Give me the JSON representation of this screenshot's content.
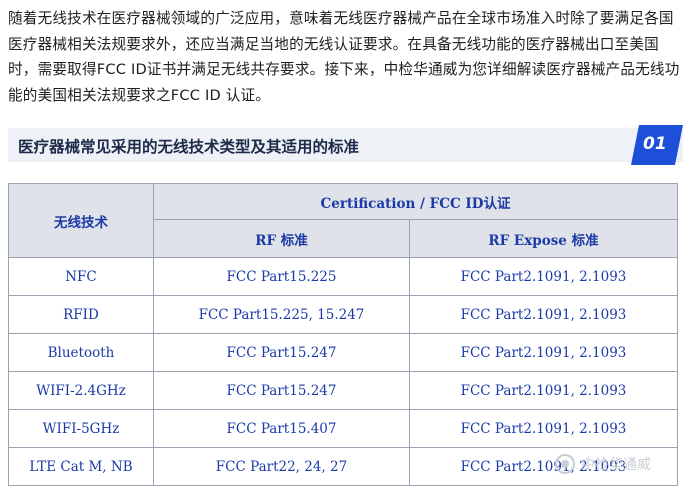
{
  "intro": "随着无线技术在医疗器械领域的广泛应用，意味着无线医疗器械产品在全球市场准入时除了要满足各国医疗器械相关法规要求外，还应当满足当地的无线认证要求。在具备无线功能的医疗器械出口至美国时，需要取得FCC ID证书并满足无线共存要求。接下来，中检华通威为您详细解读医疗器械产品无线功能的美国相关法规要求之FCC ID 认证。",
  "section": {
    "title": "医疗器械常见采用的无线技术类型及其适用的标准",
    "number": "01",
    "accent_color": "#1d4fd8"
  },
  "table": {
    "col_tech": "无线技术",
    "group_header": "Certification / FCC ID认证",
    "col_rf": "RF 标准",
    "col_expose": "RF Expose 标准",
    "rows": [
      {
        "tech": "NFC",
        "rf": "FCC Part15.225",
        "expose": "FCC Part2.1091, 2.1093"
      },
      {
        "tech": "RFID",
        "rf": "FCC Part15.225, 15.247",
        "expose": "FCC Part2.1091, 2.1093"
      },
      {
        "tech": "Bluetooth",
        "rf": "FCC Part15.247",
        "expose": "FCC Part2.1091, 2.1093"
      },
      {
        "tech": "WIFI-2.4GHz",
        "rf": "FCC Part15.247",
        "expose": "FCC Part2.1091, 2.1093"
      },
      {
        "tech": "WIFI-5GHz",
        "rf": "FCC Part15.407",
        "expose": "FCC Part2.1091, 2.1093"
      },
      {
        "tech": "LTE Cat M, NB",
        "rf": "FCC Part22, 24, 27",
        "expose": "FCC Part2.1091, 2.1093"
      }
    ]
  },
  "watermark": {
    "text": "中检华通威",
    "icon": "wechat-icon"
  }
}
